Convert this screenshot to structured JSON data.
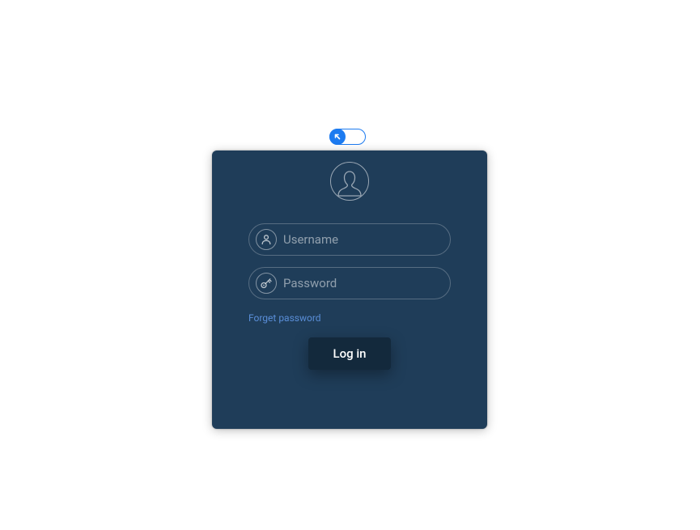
{
  "toggle": {
    "position": "left",
    "icon": "arrow-up-left"
  },
  "login": {
    "username_placeholder": "Username",
    "username_value": "",
    "password_placeholder": "Password",
    "password_value": "",
    "forget_label": "Forget password",
    "submit_label": "Log in"
  }
}
